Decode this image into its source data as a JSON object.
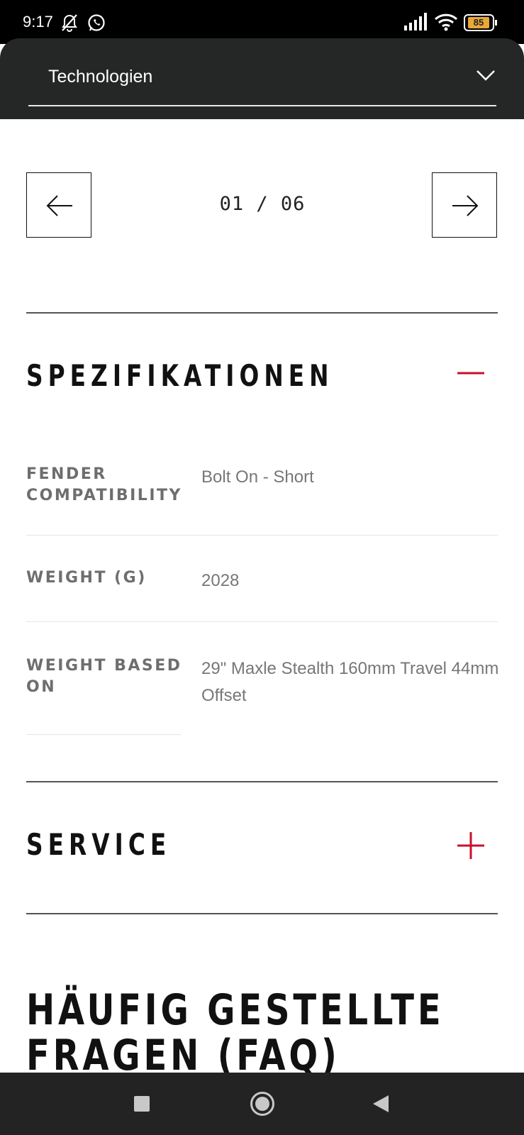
{
  "status_bar": {
    "time": "9:17",
    "icons": [
      "muted-bell-icon",
      "whatsapp-icon",
      "signal-icon",
      "wifi-icon",
      "battery-icon"
    ],
    "battery_level": "85"
  },
  "dropdown": {
    "label": "Technologien",
    "icon": "chevron-down-icon"
  },
  "pager": {
    "counter": "01 / 06",
    "prev_icon": "arrow-left-icon",
    "next_icon": "arrow-right-icon"
  },
  "specifications": {
    "title": "SPEZIFIKATIONEN",
    "toggle_icon": "minus-icon",
    "accent_color": "#c8102e",
    "rows": [
      {
        "label": "FENDER COMPATIBILITY",
        "value": "Bolt On - Short"
      },
      {
        "label": "WEIGHT (G)",
        "value": "2028"
      },
      {
        "label": "WEIGHT BASED ON",
        "value": "29\" Maxle Stealth 160mm Travel 44mm Offset"
      }
    ]
  },
  "service": {
    "title": "SERVICE",
    "toggle_icon": "plus-icon"
  },
  "faq": {
    "title_line1": "HÄUFIG GESTELLTE",
    "title_line2": "FRAGEN (FAQ)"
  },
  "nav_bar": {
    "icons": [
      "recents-square-icon",
      "home-circle-icon",
      "back-triangle-icon"
    ]
  }
}
